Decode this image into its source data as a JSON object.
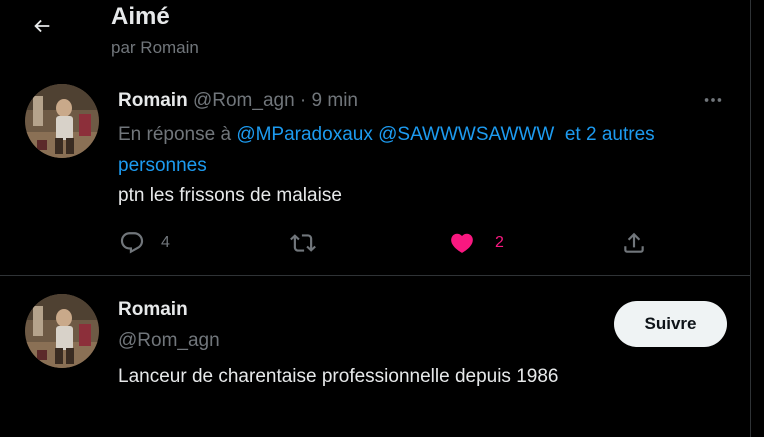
{
  "header": {
    "title": "Aimé",
    "subtitle": "par Romain",
    "back_icon": "arrow-left-icon"
  },
  "tweet": {
    "author_name": "Romain",
    "author_handle": "@Rom_agn",
    "separator": "·",
    "time": "9 min",
    "reply_prefix": "En réponse à",
    "reply_mentions": [
      "@MParadoxaux",
      "@SAWWWSAWWW"
    ],
    "reply_and": "et",
    "reply_others": "2 autres personnes",
    "text": "ptn les frissons de malaise",
    "actions": {
      "reply_count": "4",
      "retweet_count": "",
      "like_count": "2",
      "share_count": ""
    },
    "liked": true
  },
  "user_card": {
    "name": "Romain",
    "handle": "@Rom_agn",
    "bio": "Lanceur de charentaise professionnelle depuis 1986",
    "follow_label": "Suivre"
  },
  "colors": {
    "background": "#000000",
    "text_primary": "#e7e9ea",
    "text_secondary": "#71767b",
    "link": "#1d9bf0",
    "like": "#f91880",
    "divider": "#2f3336",
    "button_bg": "#eff3f4"
  }
}
